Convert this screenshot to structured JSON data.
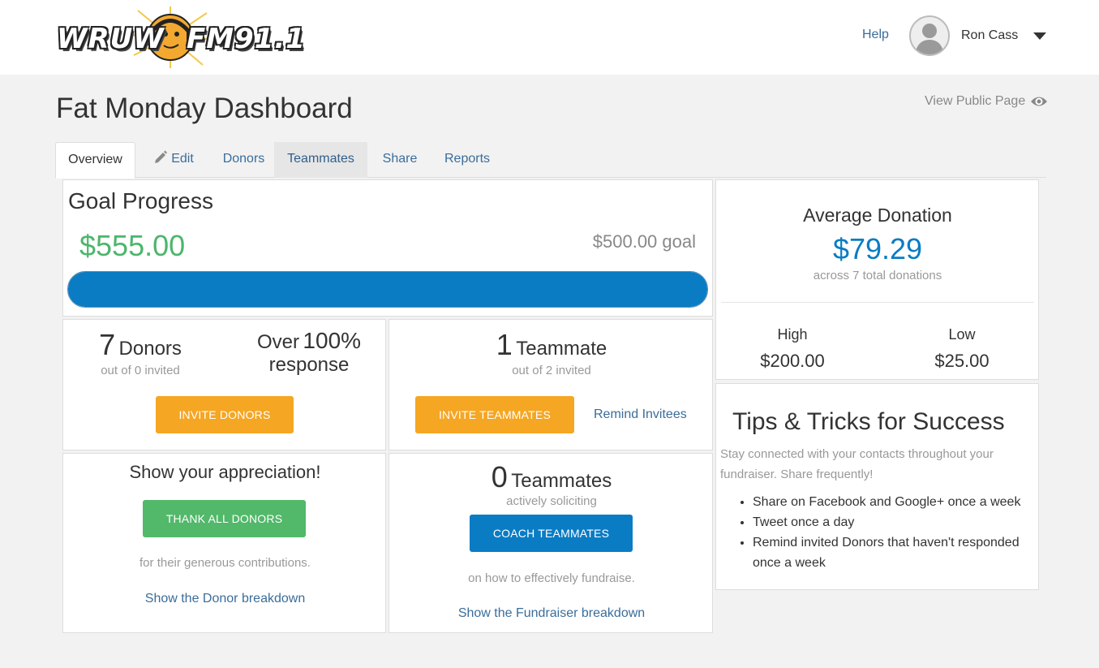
{
  "header": {
    "logo_left": "WRUW",
    "logo_right": "FM91.1",
    "help": "Help",
    "user_name": "Ron Cass"
  },
  "page": {
    "title": "Fat Monday Dashboard",
    "view_public": "View Public Page"
  },
  "tabs": [
    {
      "label": "Overview",
      "state": "active"
    },
    {
      "label": "Edit",
      "icon": "pencil-icon"
    },
    {
      "label": "Donors"
    },
    {
      "label": "Teammates",
      "state": "hover"
    },
    {
      "label": "Share"
    },
    {
      "label": "Reports"
    }
  ],
  "goal": {
    "title": "Goal Progress",
    "raised": "$555.00",
    "goal_text": "$500.00 goal",
    "progress_fraction": 1.0
  },
  "donors": {
    "count": "7",
    "label": "Donors",
    "sub": "out of 0 invited",
    "over": "Over",
    "percent": "100%",
    "response": "response",
    "button": "INVITE DONORS"
  },
  "teammates": {
    "count": "1",
    "label": "Teammate",
    "sub": "out of 2 invited",
    "button": "INVITE TEAMMATES",
    "remind": "Remind Invitees"
  },
  "appreciation": {
    "title": "Show your appreciation!",
    "button": "THANK ALL DONORS",
    "sub": "for their generous contributions.",
    "link": "Show the Donor breakdown"
  },
  "soliciting": {
    "count": "0",
    "label": "Teammates",
    "sub": "actively soliciting",
    "button": "COACH TEAMMATES",
    "note": "on how to effectively fundraise.",
    "link": "Show the Fundraiser breakdown"
  },
  "average": {
    "title": "Average Donation",
    "value": "$79.29",
    "sub": "across 7 total donations",
    "high_label": "High",
    "high_value": "$200.00",
    "low_label": "Low",
    "low_value": "$25.00"
  },
  "tips": {
    "title": "Tips & Tricks for Success",
    "intro": "Stay connected with your contacts throughout your fundraiser. Share frequently!",
    "items": [
      "Share on Facebook and Google+ once a week",
      "Tweet once a day",
      "Remind invited Donors that haven't responded once a week"
    ]
  },
  "colors": {
    "accent_blue": "#0a7cc4",
    "success_green": "#4cb66b",
    "button_orange": "#f5a623",
    "link_blue": "#3a6d9a"
  }
}
